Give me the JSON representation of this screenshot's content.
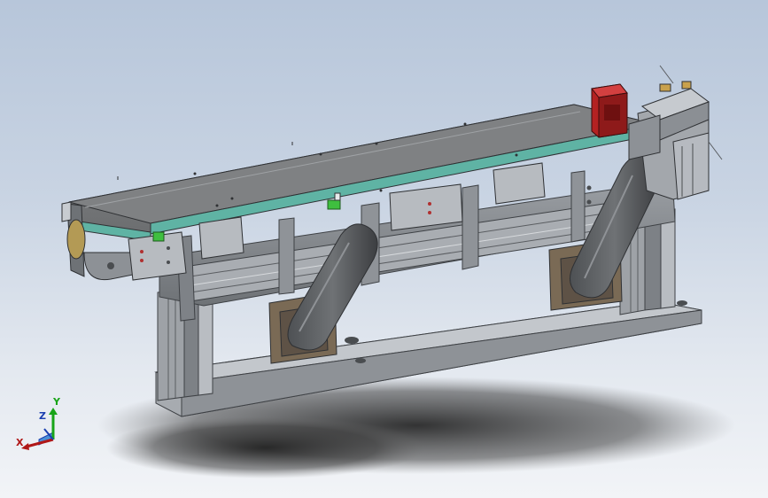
{
  "viewport": {
    "background_top": "#b7c6da",
    "background_bottom": "#f2f4f7"
  },
  "model": {
    "colors": {
      "frame_dark": "#5f6266",
      "frame_mid": "#8c9095",
      "frame_light": "#b4b8bd",
      "belt_top": "#7c7e80",
      "rail_teal": "#5fb3a4",
      "red_block": "#b32222",
      "green_sensor": "#3fbf3f",
      "shadow": "#3a3a3a"
    }
  },
  "triad": {
    "x_label": "X",
    "y_label": "Y",
    "z_label": "Z",
    "x_color": "#b01818",
    "y_color": "#18a418",
    "z_color": "#1a3fb0"
  }
}
